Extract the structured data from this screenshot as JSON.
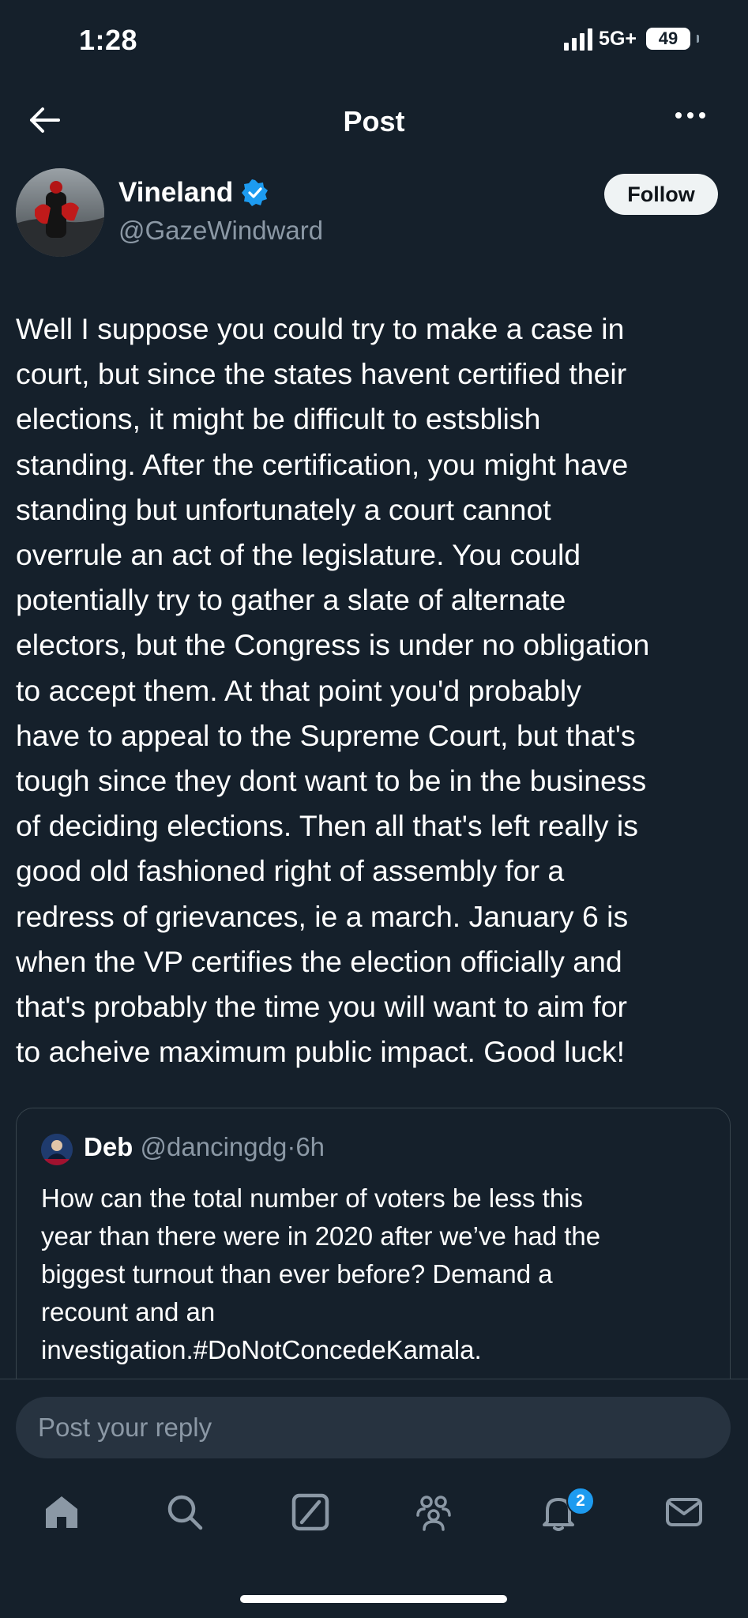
{
  "status_bar": {
    "time": "1:28",
    "network": "5G+",
    "battery": "49"
  },
  "header": {
    "title": "Post",
    "back_icon": "arrow-left-icon",
    "more_icon": "more-horizontal-icon"
  },
  "author": {
    "name": "Vineland",
    "handle": "@GazeWindward",
    "verified": true,
    "follow_label": "Follow"
  },
  "post": {
    "lines": [
      "Well I suppose you could try to make a case in",
      "court, but since the states havent certified their",
      "elections, it might be difficult to estsblish",
      "standing. After the certification, you might have",
      "standing but unfortunately a court cannot",
      "overrule an act of the legislature. You could",
      "potentially try to gather a slate of alternate",
      "electors, but the Congress is under no obligation",
      "to accept them. At that point you'd probably",
      "have to appeal to the Supreme Court, but that's",
      "tough since they dont want to be in the business",
      "of deciding elections. Then all that's left really is",
      "good old fashioned right of assembly for a",
      "redress of grievances, ie a march. January 6 is",
      "when the VP certifies the election officially and",
      "that's probably the time you will want to aim for",
      "to acheive maximum public impact. Good luck!"
    ]
  },
  "quoted": {
    "name": "Deb",
    "handle": "@dancingdg",
    "separator": "·",
    "time": "6h",
    "lines": [
      "How can the total number of voters be less this",
      "year than there were in 2020 after we’ve had the",
      "biggest turnout than ever before? Demand a",
      "recount and an",
      "investigation.#DoNotConcedeKamala."
    ]
  },
  "reply": {
    "placeholder": "Post your reply"
  },
  "nav": {
    "items": [
      "home-icon",
      "search-icon",
      "grok-icon",
      "communities-icon",
      "notifications-icon",
      "messages-icon"
    ],
    "notification_count": "2"
  },
  "colors": {
    "background": "#15202b",
    "accent": "#1d9bf0",
    "secondary_text": "#8b98a5",
    "border": "#38444d"
  }
}
